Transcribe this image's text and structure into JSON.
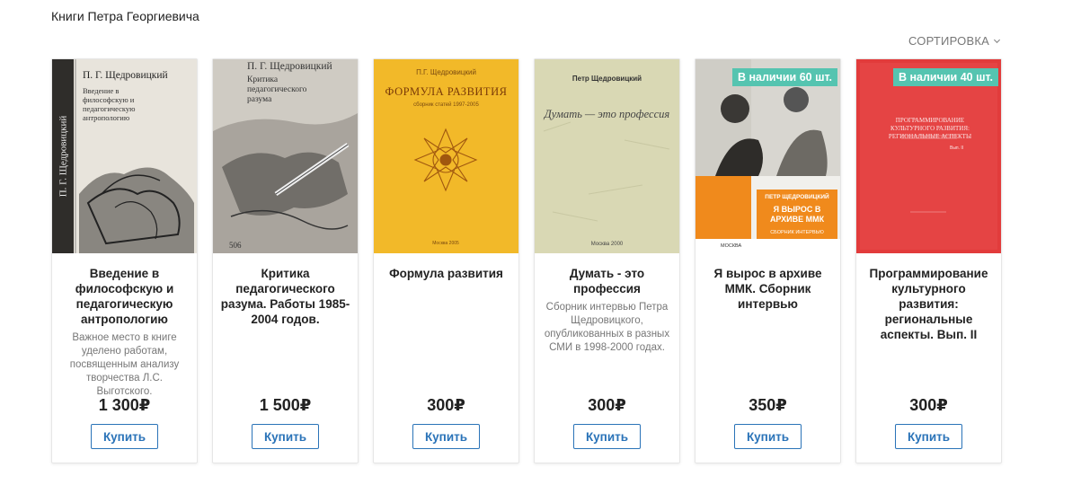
{
  "page": {
    "title": "Книги Петра Георгиевича",
    "sort_label": "СОРТИРОВКА"
  },
  "colors": {
    "accent": "#2a73b8",
    "badge": "#55c4b0"
  },
  "books": [
    {
      "title": "Введение в философскую и педагогическую антропологию",
      "description": "Важное место в книге уделено работам, посвященным анализу творчества Л.С. Выготского.",
      "price": "1 300₽",
      "buy_label": "Купить",
      "stock": "",
      "cover": {
        "author": "П. Г. Щедровицкий",
        "title": "Введение в философскую и педагогическую антропологию",
        "spine": "П. Г. Щедровицкий"
      }
    },
    {
      "title": "Критика педагогического разума. Работы 1985-2004 годов.",
      "description": "",
      "price": "1 500₽",
      "buy_label": "Купить",
      "stock": "",
      "cover": {
        "author": "П. Г. Щедровицкий",
        "title": "Критика педагогического разума"
      }
    },
    {
      "title": "Формула развития",
      "description": "",
      "price": "300₽",
      "buy_label": "Купить",
      "stock": "",
      "cover": {
        "author": "П.Г. Щедровицкий",
        "title": "ФОРМУЛА РАЗВИТИЯ",
        "subtitle": "сборник статей 1997-2005"
      }
    },
    {
      "title": "Думать - это профессия",
      "description": "Сборник интервью Петра Щедровицкого, опубликованных в разных СМИ в 1998-2000 годах.",
      "price": "300₽",
      "buy_label": "Купить",
      "stock": "",
      "cover": {
        "author": "Петр Щедровицкий",
        "title": "Думать — это профессия",
        "city": "Москва 2000"
      }
    },
    {
      "title": "Я вырос в архиве ММК. Сборник интервью",
      "description": "",
      "price": "350₽",
      "buy_label": "Купить",
      "stock": "В наличии 60 шт.",
      "cover": {
        "author": "ПЕТР ЩЕДРОВИЦКИЙ",
        "title": "Я ВЫРОС В АРХИВЕ ММК",
        "subtitle": "СБОРНИК ИНТЕРВЬЮ",
        "city": "МОСКВА"
      }
    },
    {
      "title": "Программирование культурного развития: региональные аспекты. Вып. II",
      "description": "",
      "price": "300₽",
      "buy_label": "Купить",
      "stock": "В наличии 40 шт.",
      "cover": {
        "title": "ПРОГРАММИРОВАНИЕ КУЛЬТУРНОГО РАЗВИТИЯ: РЕГИОНАЛЬНЫЕ АСПЕКТЫ",
        "subtitle": "Вып. II"
      }
    }
  ]
}
